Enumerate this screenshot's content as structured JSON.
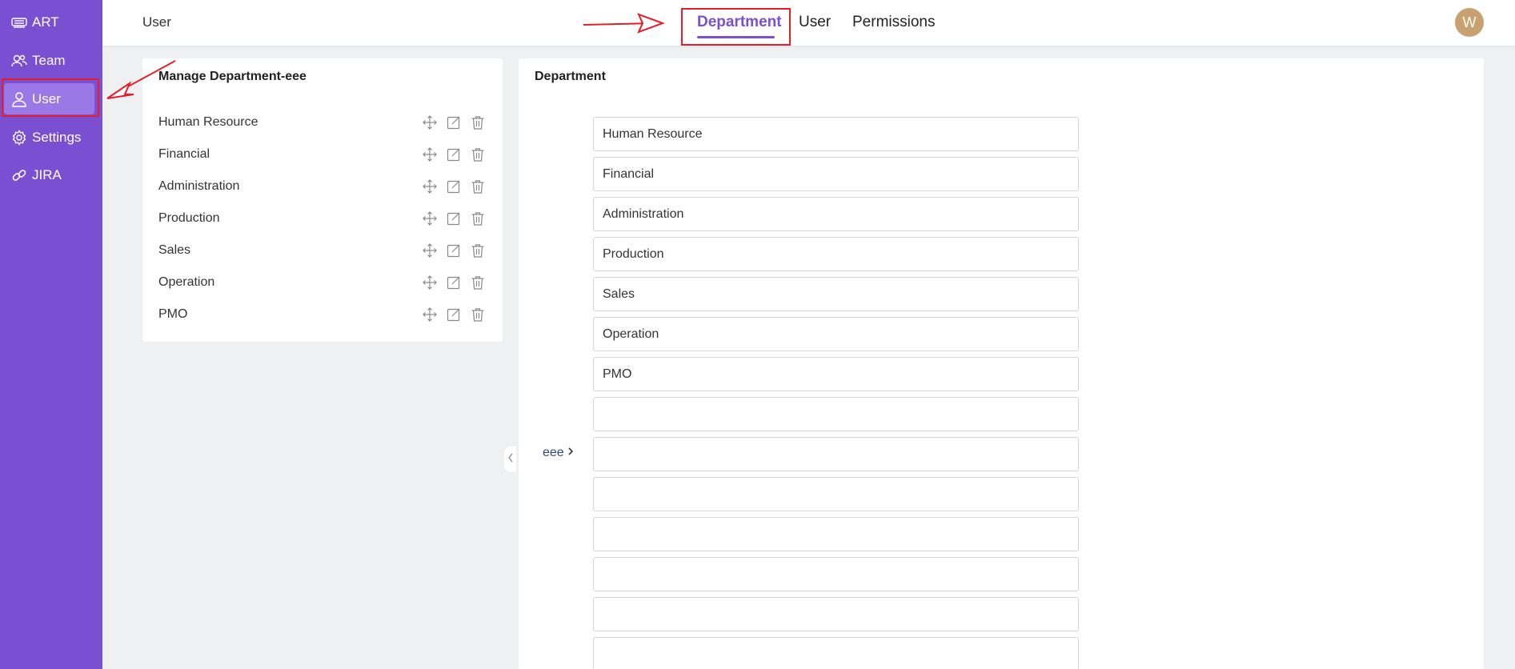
{
  "sidebar": {
    "items": [
      {
        "label": "ART",
        "icon": "car-icon"
      },
      {
        "label": "Team",
        "icon": "team-icon"
      },
      {
        "label": "User",
        "icon": "user-icon",
        "active": true
      },
      {
        "label": "Settings",
        "icon": "gear-icon"
      },
      {
        "label": "JIRA",
        "icon": "link-icon"
      }
    ]
  },
  "header": {
    "breadcrumb": "User",
    "tabs": [
      {
        "label": "Department",
        "active": true
      },
      {
        "label": "User"
      },
      {
        "label": "Permissions"
      }
    ],
    "avatar": "W"
  },
  "left_panel": {
    "title": "Manage Department-eee",
    "departments": [
      "Human Resource",
      "Financial",
      "Administration",
      "Production",
      "Sales",
      "Operation",
      "PMO"
    ]
  },
  "right_panel": {
    "title": "Department",
    "group_label": "eee",
    "fields": [
      "Human Resource",
      "Financial",
      "Administration",
      "Production",
      "Sales",
      "Operation",
      "PMO",
      "",
      "",
      "",
      "",
      "",
      "",
      ""
    ]
  },
  "colors": {
    "sidebar": "#7b4fd1",
    "sidebar_active": "#9a78e6",
    "accent": "#7b4fd1",
    "annotation": "#e3202a",
    "avatar": "#c9a06f"
  }
}
